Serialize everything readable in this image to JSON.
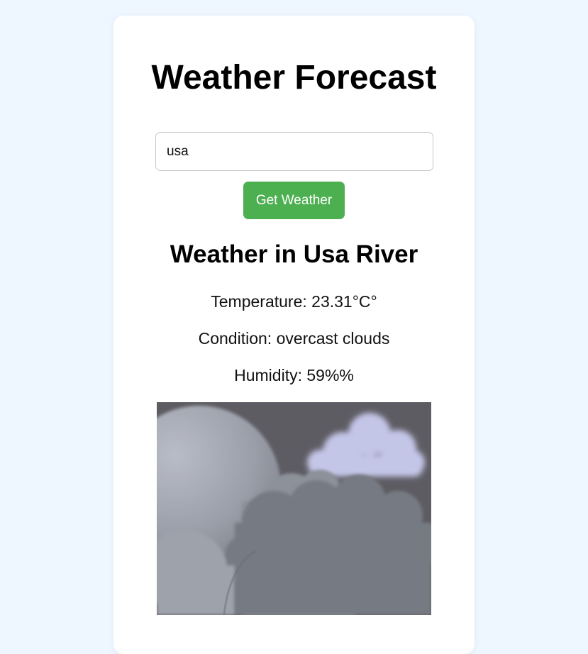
{
  "app": {
    "title": "Weather Forecast"
  },
  "search": {
    "value": "usa"
  },
  "actions": {
    "get_weather_label": "Get Weather"
  },
  "result": {
    "heading": "Weather in Usa River",
    "temperature": "Temperature: 23.31°C°",
    "condition": "Condition: overcast clouds",
    "humidity": "Humidity: 59%%"
  },
  "image": {
    "icon": "overcast-clouds-illustration"
  },
  "colors": {
    "page_background": "#eef6ff",
    "button": "#4caf50",
    "card": "#ffffff"
  }
}
